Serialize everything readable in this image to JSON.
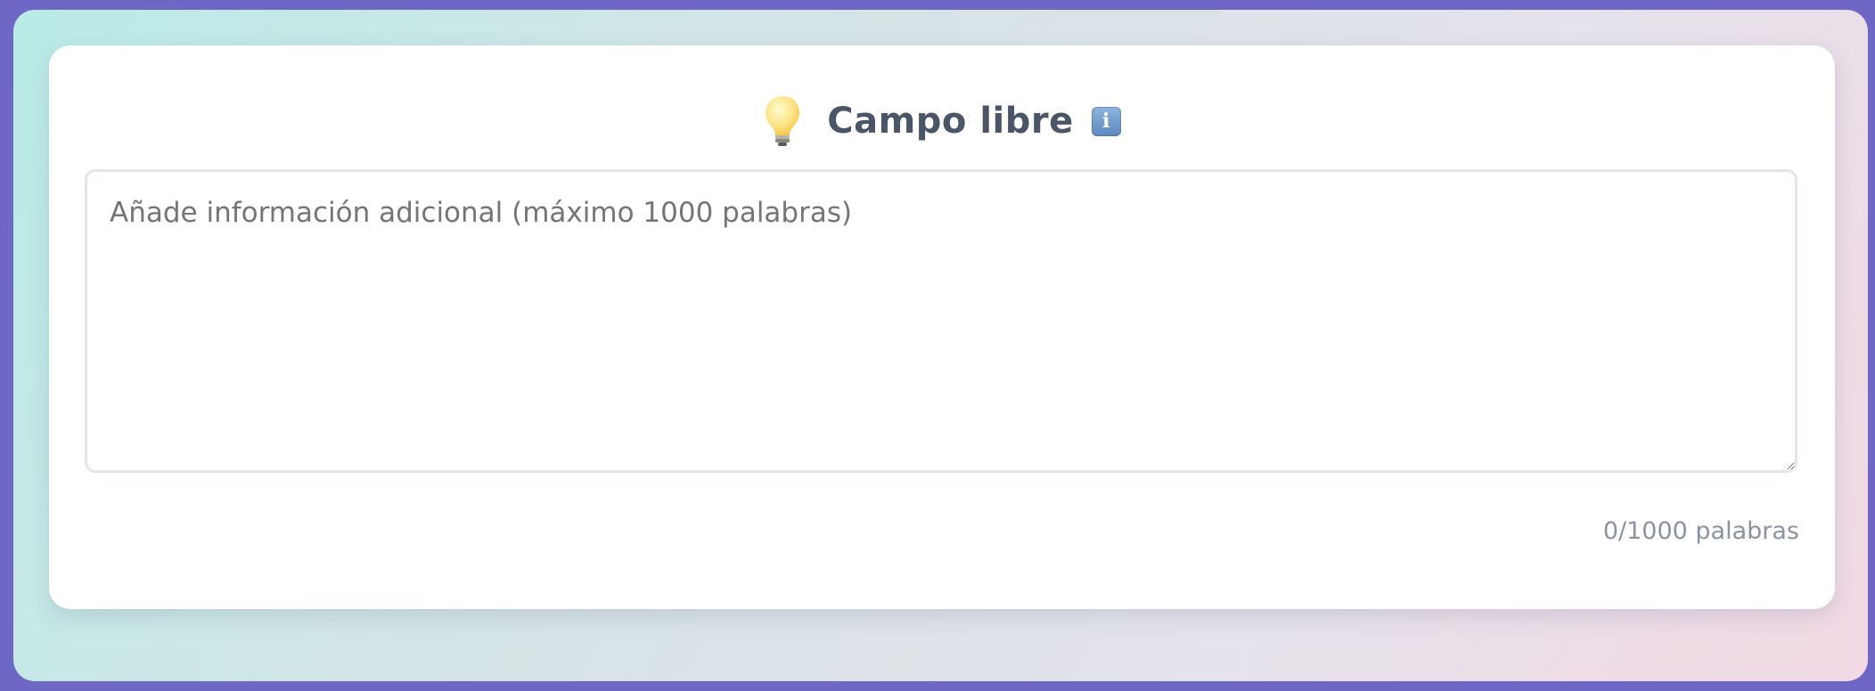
{
  "field": {
    "title": "Campo libre",
    "icon": "lightbulb-icon",
    "info_icon": "info-icon",
    "info_glyph": "i"
  },
  "textarea": {
    "value": "",
    "placeholder": "Añade información adicional (máximo 1000 palabras)"
  },
  "counter": {
    "text": "0/1000 palabras"
  },
  "colors": {
    "background": "#6f67c6",
    "title": "#4a5568",
    "counter": "#8a93a3",
    "border": "#e2e6ea"
  }
}
